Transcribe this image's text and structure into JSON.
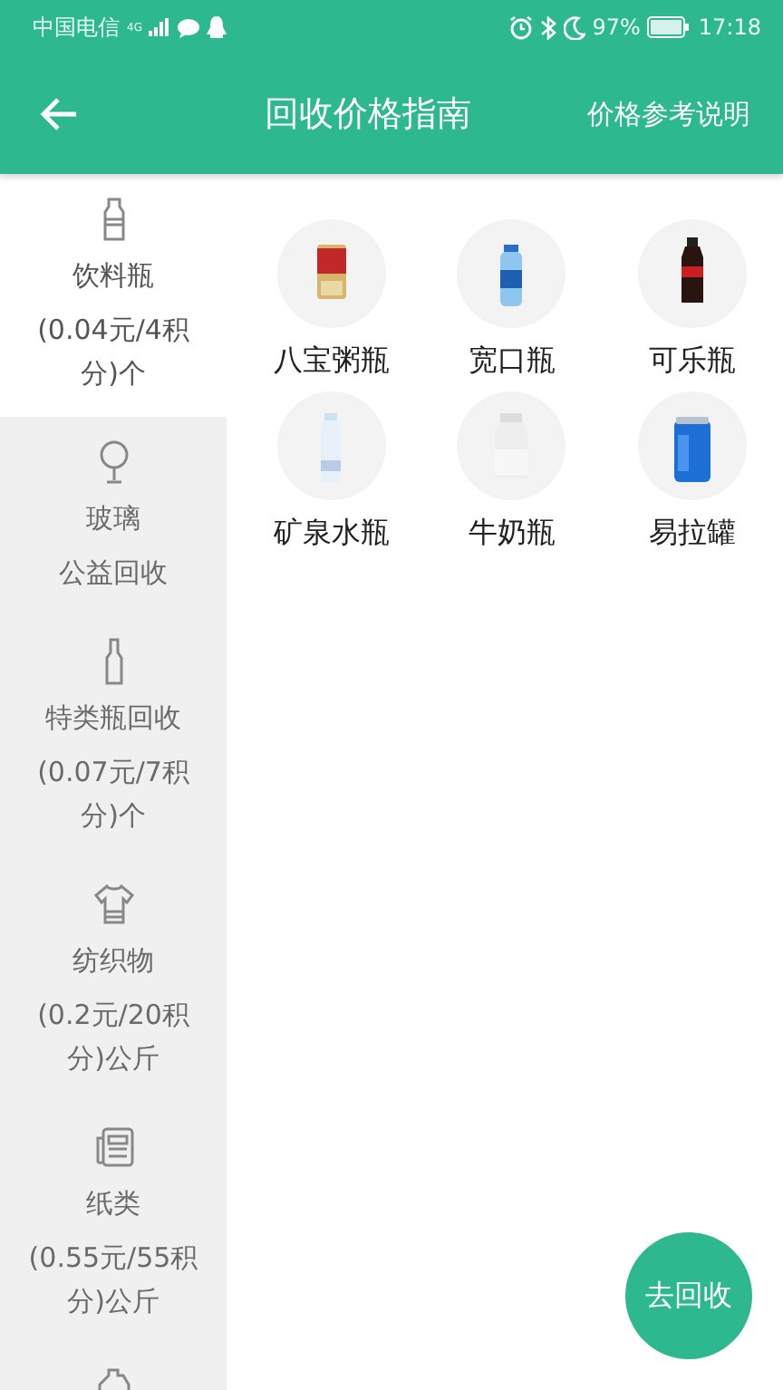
{
  "status_bar": {
    "carrier": "中国电信",
    "network": "4G",
    "battery_percent": "97%",
    "time": "17:18"
  },
  "header": {
    "title": "回收价格指南",
    "action": "价格参考说明"
  },
  "sidebar": {
    "items": [
      {
        "kind": "bottle",
        "name": "饮料瓶",
        "price": "(0.04元/4积分)个",
        "selected": true
      },
      {
        "kind": "glass",
        "name": "玻璃",
        "price": "公益回收",
        "selected": false
      },
      {
        "kind": "tall_bottle",
        "name": "特类瓶回收",
        "price": "(0.07元/7积分)个",
        "selected": false
      },
      {
        "kind": "shirt",
        "name": "纺织物",
        "price": "(0.2元/20积分)公斤",
        "selected": false
      },
      {
        "kind": "newspaper",
        "name": "纸类",
        "price": "(0.55元/55积分)公斤",
        "selected": false
      },
      {
        "kind": "jug",
        "selected": false
      }
    ]
  },
  "products": [
    {
      "label": "八宝粥瓶",
      "kind": "picture"
    },
    {
      "label": "宽口瓶",
      "kind": "picture"
    },
    {
      "label": "可乐瓶",
      "kind": "picture"
    },
    {
      "label": "矿泉水瓶",
      "kind": "picture"
    },
    {
      "label": "牛奶瓶",
      "kind": "picture"
    },
    {
      "label": "易拉罐",
      "kind": "picture"
    }
  ],
  "fab": {
    "label": "去回收"
  }
}
